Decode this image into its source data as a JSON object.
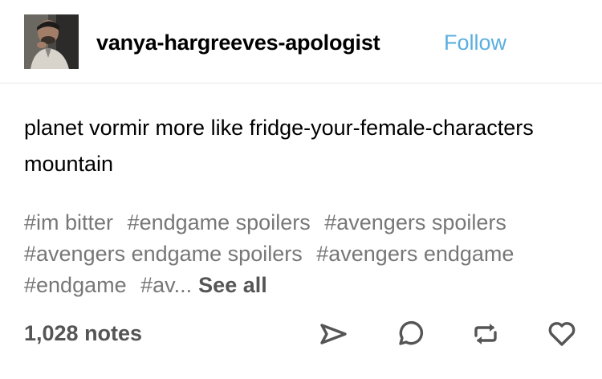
{
  "post": {
    "username": "vanya-hargreeves-apologist",
    "follow_label": "Follow",
    "body": "planet vormir more like fridge-your-female-characters mountain",
    "tags": [
      "#im bitter",
      "#endgame spoilers",
      "#avengers spoilers",
      "#avengers endgame spoilers",
      "#avengers endgame",
      "#endgame"
    ],
    "truncated_tag": "#av...",
    "see_all_label": "See all",
    "notes": "1,028 notes"
  },
  "colors": {
    "follow": "#5bafe0",
    "tags": "#777777",
    "notes": "#555555",
    "divider": "#e8e8e8"
  },
  "icons": [
    "share-icon",
    "reply-icon",
    "reblog-icon",
    "heart-icon"
  ]
}
